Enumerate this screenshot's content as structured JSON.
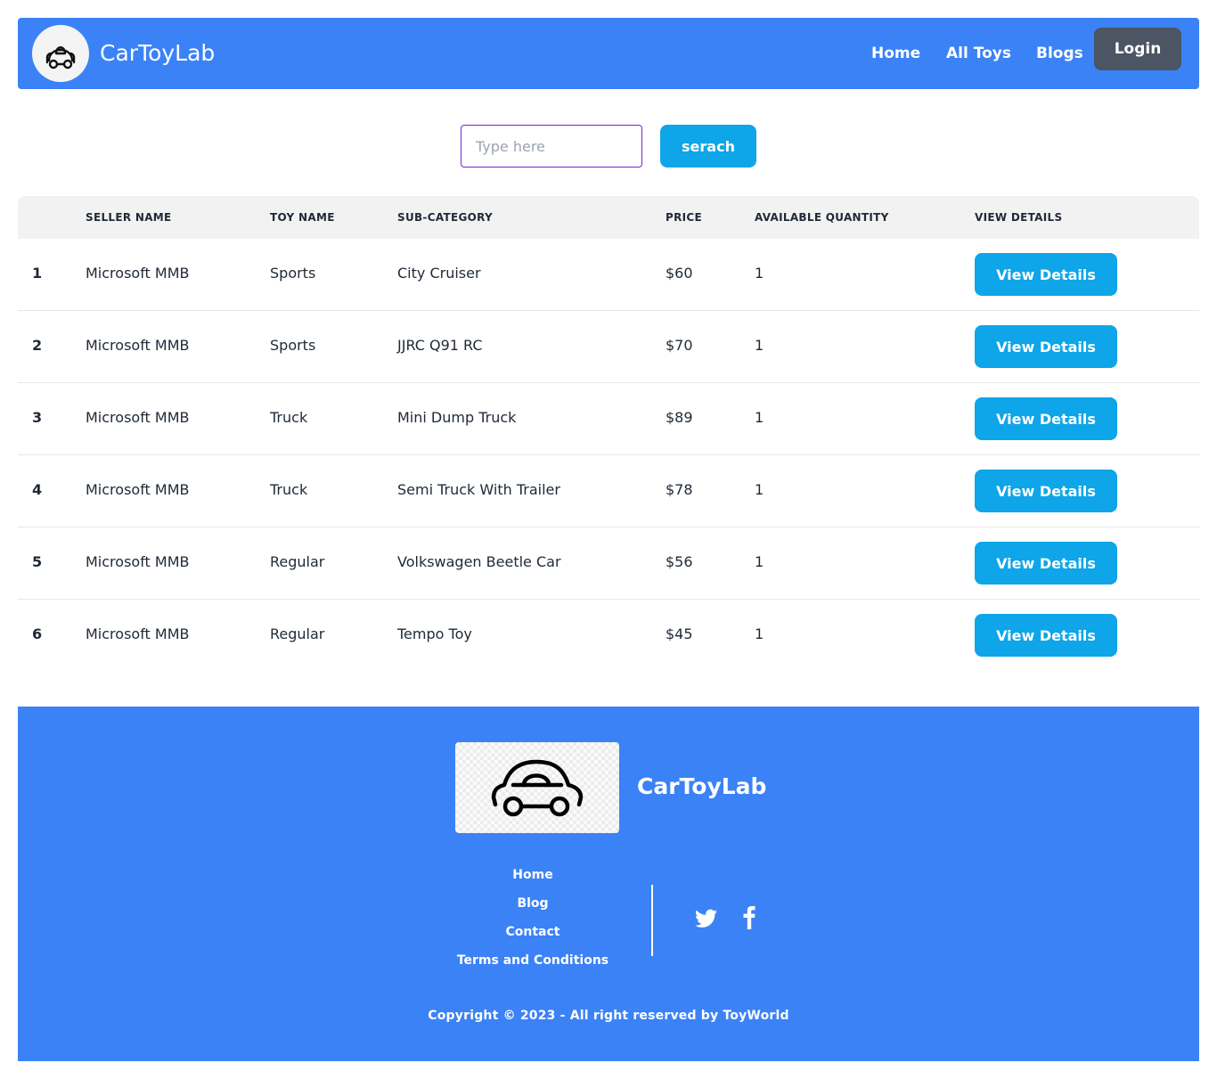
{
  "nav": {
    "brand": "CarToyLab",
    "links": [
      "Home",
      "All Toys",
      "Blogs"
    ],
    "login_label": "Login"
  },
  "search": {
    "placeholder": "Type here",
    "value": "",
    "button_label": "serach"
  },
  "table": {
    "headers": [
      "",
      "SELLER NAME",
      "TOY NAME",
      "SUB-CATEGORY",
      "PRICE",
      "AVAILABLE QUANTITY",
      "VIEW DETAILS"
    ],
    "rows": [
      {
        "index": "1",
        "seller": "Microsoft MMB",
        "toy_name": "Sports",
        "sub_category": "City Cruiser",
        "price": "$60",
        "quantity": "1",
        "action": "View Details"
      },
      {
        "index": "2",
        "seller": "Microsoft MMB",
        "toy_name": "Sports",
        "sub_category": "JJRC Q91 RC",
        "price": "$70",
        "quantity": "1",
        "action": "View Details"
      },
      {
        "index": "3",
        "seller": "Microsoft MMB",
        "toy_name": "Truck",
        "sub_category": "Mini Dump Truck",
        "price": "$89",
        "quantity": "1",
        "action": "View Details"
      },
      {
        "index": "4",
        "seller": "Microsoft MMB",
        "toy_name": "Truck",
        "sub_category": "Semi Truck With Trailer",
        "price": "$78",
        "quantity": "1",
        "action": "View Details"
      },
      {
        "index": "5",
        "seller": "Microsoft MMB",
        "toy_name": "Regular",
        "sub_category": "Volkswagen Beetle Car",
        "price": "$56",
        "quantity": "1",
        "action": "View Details"
      },
      {
        "index": "6",
        "seller": "Microsoft MMB",
        "toy_name": "Regular",
        "sub_category": "Tempo Toy",
        "price": "$45",
        "quantity": "1",
        "action": "View Details"
      }
    ]
  },
  "footer": {
    "brand": "CarToyLab",
    "links": [
      "Home",
      "Blog",
      "Contact",
      "Terms and Conditions"
    ],
    "social": [
      "twitter-icon",
      "facebook-icon"
    ],
    "copyright": "Copyright © 2023 - All right reserved by ToyWorld"
  },
  "colors": {
    "primary": "#3b82f6",
    "accent": "#0ea5e9",
    "login_bg": "#4b5563",
    "header_row_bg": "#f2f2f2",
    "input_border": "#7e22ce"
  }
}
